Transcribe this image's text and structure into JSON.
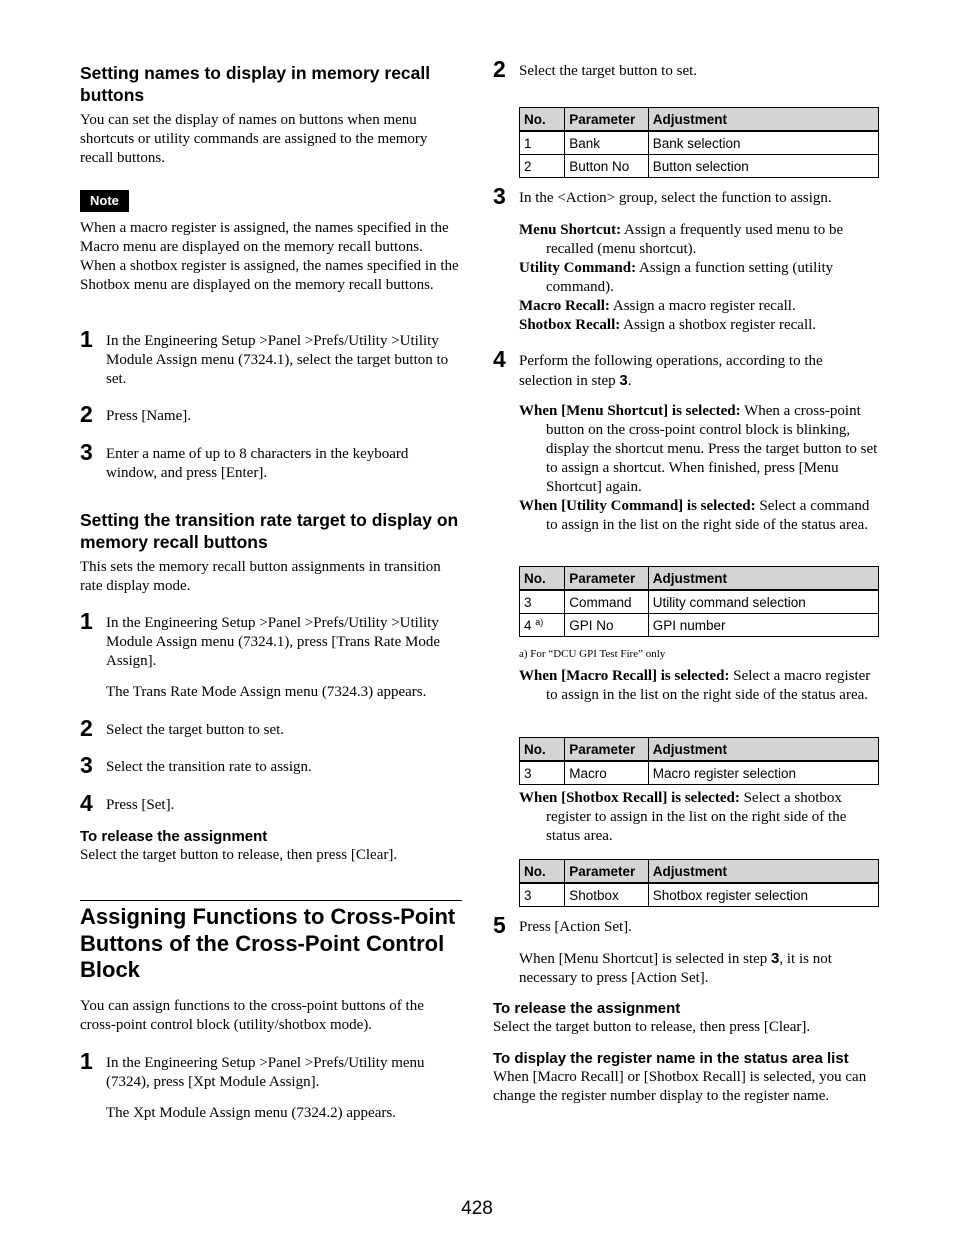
{
  "left": {
    "section1": {
      "heading": "Setting names to display in memory recall buttons",
      "intro": "You can set the display of names on buttons when menu shortcuts or utility commands are assigned to the memory recall buttons.",
      "note_label": "Note",
      "note_text": "When a macro register is assigned, the names specified in the Macro menu are displayed on the memory recall buttons. When a shotbox register is assigned, the names specified in the Shotbox menu are displayed on the memory recall buttons.",
      "steps": [
        {
          "num": "1",
          "text": "In the Engineering Setup >Panel >Prefs/Utility >Utility Module Assign menu (7324.1), select the target button to set."
        },
        {
          "num": "2",
          "text": "Press [Name]."
        },
        {
          "num": "3",
          "text": "Enter a name of up to 8 characters in the keyboard window, and press [Enter]."
        }
      ]
    },
    "section2": {
      "heading": "Setting the transition rate target to display on memory recall buttons",
      "intro": "This sets the memory recall button assignments in transition rate display mode.",
      "steps": [
        {
          "num": "1",
          "text": "In the Engineering Setup >Panel >Prefs/Utility >Utility Module Assign menu (7324.1), press [Trans Rate Mode Assign].",
          "sub": "The Trans Rate Mode Assign menu (7324.3) appears."
        },
        {
          "num": "2",
          "text": "Select the target button to set."
        },
        {
          "num": "3",
          "text": "Select the transition rate to assign."
        },
        {
          "num": "4",
          "text": "Press [Set]."
        }
      ],
      "release_heading": "To release the assignment",
      "release_text": "Select the target button to release, then press [Clear]."
    },
    "section3": {
      "heading": "Assigning Functions to Cross-Point Buttons of the Cross-Point Control Block",
      "intro": "You can assign functions to the cross-point buttons of the cross-point control block (utility/shotbox mode).",
      "steps": [
        {
          "num": "1",
          "text": "In the Engineering Setup >Panel >Prefs/Utility menu (7324), press [Xpt Module Assign].",
          "sub": "The Xpt Module Assign menu (7324.2) appears."
        }
      ]
    }
  },
  "right": {
    "step2": {
      "num": "2",
      "text": "Select the target button to set."
    },
    "table_headers": [
      "No.",
      "Parameter",
      "Adjustment"
    ],
    "table1": [
      [
        "1",
        "Bank",
        "Bank selection"
      ],
      [
        "2",
        "Button No",
        "Button selection"
      ]
    ],
    "step3": {
      "num": "3",
      "text": "In the <Action> group, select the function to assign."
    },
    "actions": [
      {
        "term": "Menu Shortcut:",
        "desc": " Assign a frequently used menu to be recalled (menu shortcut)."
      },
      {
        "term": "Utility Command:",
        "desc": " Assign a function setting (utility command)."
      },
      {
        "term": "Macro Recall:",
        "desc": " Assign a macro register recall."
      },
      {
        "term": "Shotbox Recall:",
        "desc": " Assign a shotbox register recall."
      }
    ],
    "step4": {
      "num": "4",
      "text_before": "Perform the following operations, according to the selection in step ",
      "step_ref": "3",
      "text_after": "."
    },
    "when_menu": {
      "term": "When [Menu Shortcut] is selected:",
      "desc": " When a cross-point button on the cross-point control block is blinking, display the shortcut menu. Press the target button to set to assign a shortcut. When finished, press [Menu Shortcut] again."
    },
    "when_utility": {
      "term": "When [Utility Command] is selected:",
      "desc": " Select a command to assign in the list on the right side of the status area."
    },
    "table2": [
      [
        "3",
        "Command",
        "Utility command selection"
      ],
      [
        "4",
        "GPI No",
        "GPI number"
      ]
    ],
    "table2_footnote_mark": "a)",
    "footnote": "a) For “DCU GPI Test Fire” only",
    "when_macro": {
      "term": "When [Macro Recall] is selected:",
      "desc": " Select a macro register to assign in the list on the right side of the status area."
    },
    "table3": [
      [
        "3",
        "Macro",
        "Macro register selection"
      ]
    ],
    "when_shotbox": {
      "term": "When [Shotbox Recall] is selected:",
      "desc": " Select a shotbox register to assign in the list on the right side of the status area."
    },
    "table4": [
      [
        "3",
        "Shotbox",
        "Shotbox register selection"
      ]
    ],
    "step5": {
      "num": "5",
      "text": "Press [Action Set].",
      "sub_before": "When [Menu Shortcut] is selected in step ",
      "sub_ref": "3",
      "sub_after": ", it is not necessary to press [Action Set]."
    },
    "release_heading": "To release the assignment",
    "release_text": "Select the target button to release, then press [Clear].",
    "display_heading": "To display the register name in the status area list",
    "display_text": "When [Macro Recall] or [Shotbox Recall] is selected, you can change the register number display to the register name."
  },
  "page_number": "428"
}
